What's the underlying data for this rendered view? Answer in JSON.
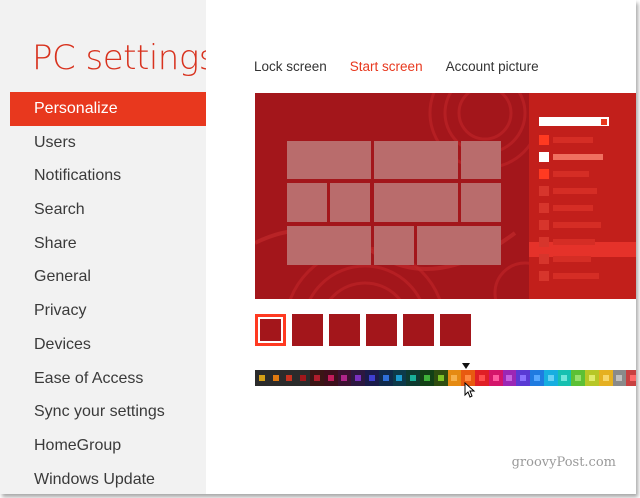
{
  "app": {
    "title": "PC settings"
  },
  "sidebar": {
    "items": [
      {
        "label": "Personalize",
        "active": true
      },
      {
        "label": "Users"
      },
      {
        "label": "Notifications"
      },
      {
        "label": "Search"
      },
      {
        "label": "Share"
      },
      {
        "label": "General"
      },
      {
        "label": "Privacy"
      },
      {
        "label": "Devices"
      },
      {
        "label": "Ease of Access"
      },
      {
        "label": "Sync your settings"
      },
      {
        "label": "HomeGroup"
      },
      {
        "label": "Windows Update"
      }
    ]
  },
  "tabs": [
    {
      "label": "Lock screen"
    },
    {
      "label": "Start screen",
      "active": true
    },
    {
      "label": "Account picture"
    }
  ],
  "colors": {
    "accent": "#e8381e",
    "start_background": "#a3161b",
    "tile": "#b96c6c",
    "sidebar_bg": "#f2f2f2"
  },
  "background_patterns": {
    "count": 6,
    "selected_index": 0
  },
  "color_strip": {
    "selected_index": 16,
    "swatches": [
      {
        "bg": "#2b2b2b",
        "dot": "#d4a017"
      },
      {
        "bg": "#2b2b2b",
        "dot": "#e07a10"
      },
      {
        "bg": "#2b2b2b",
        "dot": "#c8321f"
      },
      {
        "bg": "#2b2b2b",
        "dot": "#a0171b"
      },
      {
        "bg": "#3a1515",
        "dot": "#b01d2c"
      },
      {
        "bg": "#3d0f1c",
        "dot": "#c21b5a"
      },
      {
        "bg": "#3c1131",
        "dot": "#b0258a"
      },
      {
        "bg": "#2c1840",
        "dot": "#7a30c0"
      },
      {
        "bg": "#1b1b4a",
        "dot": "#3f3fd0"
      },
      {
        "bg": "#102a4a",
        "dot": "#2f6fd8"
      },
      {
        "bg": "#0d3a4a",
        "dot": "#1b9bd0"
      },
      {
        "bg": "#0e3a30",
        "dot": "#19b09a"
      },
      {
        "bg": "#124016",
        "dot": "#3fb33a"
      },
      {
        "bg": "#2f4d10",
        "dot": "#7cc225"
      },
      {
        "bg": "#e58a12",
        "dot": "#f6b04a"
      },
      {
        "bg": "#e85a10",
        "dot": "#ff8a40"
      },
      {
        "bg": "#e01f26",
        "dot": "#ff4d4d"
      },
      {
        "bg": "#d4156a",
        "dot": "#ff5aa0"
      },
      {
        "bg": "#9b27b5",
        "dot": "#c661e0"
      },
      {
        "bg": "#5a3ad4",
        "dot": "#8a70ff"
      },
      {
        "bg": "#1f7be0",
        "dot": "#55a8ff"
      },
      {
        "bg": "#17aee0",
        "dot": "#66d1f5"
      },
      {
        "bg": "#16c0b0",
        "dot": "#6fe6da"
      },
      {
        "bg": "#5cc035",
        "dot": "#96e06d"
      },
      {
        "bg": "#b7c726",
        "dot": "#e0ec6a"
      },
      {
        "bg": "#e5b021",
        "dot": "#f7d66a"
      },
      {
        "bg": "#8a8a8a",
        "dot": "#c0c0c0"
      },
      {
        "bg": "#c84141",
        "dot": "#ff6a6a"
      }
    ]
  },
  "watermark": {
    "text": "groovyPost.com"
  }
}
